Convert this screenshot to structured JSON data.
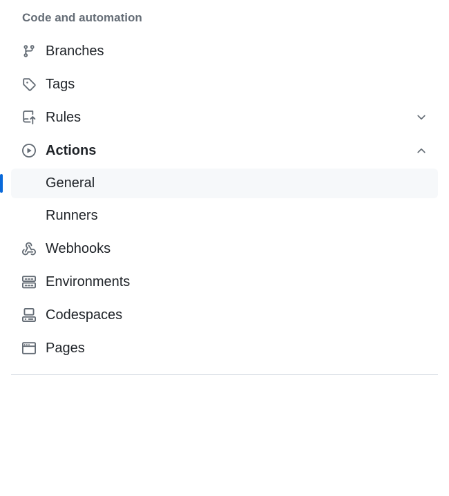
{
  "section": {
    "heading": "Code and automation",
    "items": [
      {
        "id": "branches",
        "label": "Branches"
      },
      {
        "id": "tags",
        "label": "Tags"
      },
      {
        "id": "rules",
        "label": "Rules",
        "expandable": true,
        "expanded": false
      },
      {
        "id": "actions",
        "label": "Actions",
        "expandable": true,
        "expanded": true,
        "children": [
          {
            "id": "general",
            "label": "General",
            "selected": true
          },
          {
            "id": "runners",
            "label": "Runners"
          }
        ]
      },
      {
        "id": "webhooks",
        "label": "Webhooks"
      },
      {
        "id": "environments",
        "label": "Environments"
      },
      {
        "id": "codespaces",
        "label": "Codespaces"
      },
      {
        "id": "pages",
        "label": "Pages"
      }
    ]
  }
}
